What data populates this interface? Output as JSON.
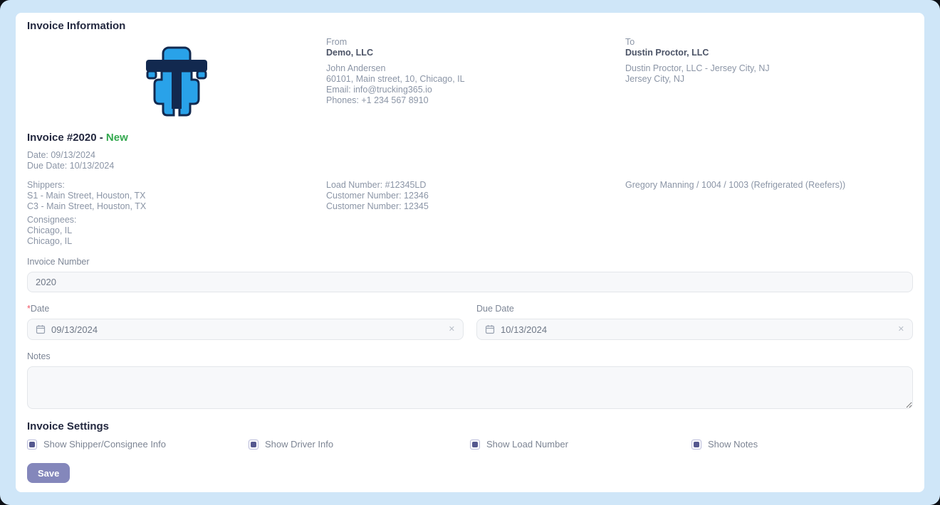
{
  "colors": {
    "page-bg": "#cfe6f8",
    "accent": "#8487bb",
    "status-green": "#33a84e",
    "required-red": "#f25767",
    "check-fill": "#55588f",
    "logo-blue": "#29a2e9",
    "logo-navy": "#12294f"
  },
  "card": {
    "title": "Invoice Information"
  },
  "from": {
    "label": "From",
    "company": "Demo, LLC",
    "lines": [
      "John Andersen",
      "60101, Main street, 10, Chicago, IL",
      "Email: info@trucking365.io",
      "Phones: +1 234 567 8910"
    ]
  },
  "to": {
    "label": "To",
    "company": "Dustin Proctor, LLC",
    "lines": [
      "Dustin Proctor, LLC - Jersey City, NJ",
      "Jersey City, NJ"
    ]
  },
  "invoice": {
    "title": "Invoice #2020 - ",
    "status": "New",
    "date_line": "Date: 09/13/2024",
    "due_date_line": "Due Date: 10/13/2024"
  },
  "shipment": {
    "shippers_label": "Shippers:",
    "shippers": [
      "S1 - Main Street, Houston, TX",
      "C3 - Main Street, Houston, TX"
    ],
    "consignees_label": "Consignees:",
    "consignees": [
      "Chicago, IL",
      "Chicago, IL"
    ],
    "load_lines": [
      "Load Number: #12345LD",
      "Customer Number: 12346",
      "Customer Number: 12345"
    ],
    "driver_line": "Gregory Manning / 1004 / 1003 (Refrigerated (Reefers))"
  },
  "form": {
    "invoice_number": {
      "label": "Invoice Number",
      "value": "2020"
    },
    "date": {
      "required_mark": "*",
      "label": "Date",
      "value": "09/13/2024",
      "clear": "✕"
    },
    "due_date": {
      "label": "Due Date",
      "value": "10/13/2024",
      "clear": "✕"
    },
    "notes": {
      "label": "Notes",
      "value": ""
    }
  },
  "settings": {
    "title": "Invoice Settings",
    "options": [
      {
        "label": "Show Shipper/Consignee Info",
        "checked": true
      },
      {
        "label": "Show Driver Info",
        "checked": true
      },
      {
        "label": "Show Load Number",
        "checked": true
      },
      {
        "label": "Show Notes",
        "checked": true
      }
    ],
    "save_label": "Save"
  }
}
